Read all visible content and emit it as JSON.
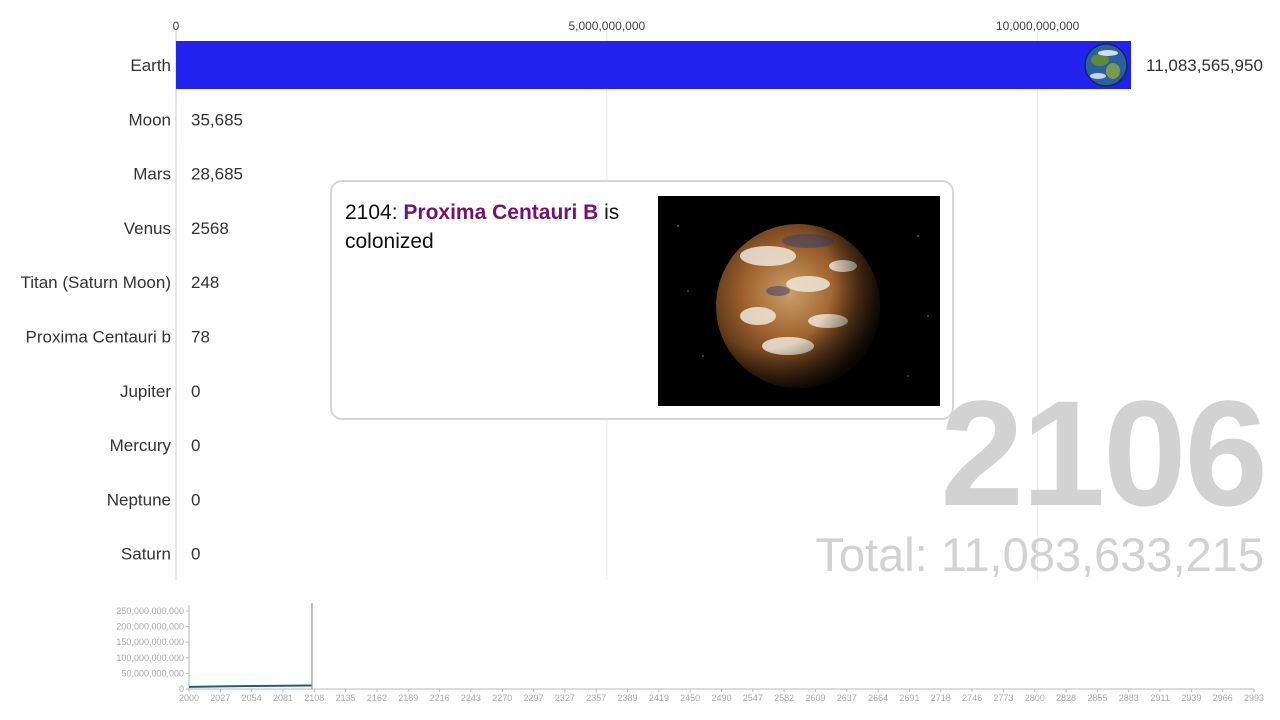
{
  "chart_data": [
    {
      "type": "bar",
      "orientation": "horizontal",
      "categories": [
        "Earth",
        "Moon",
        "Mars",
        "Venus",
        "Titan (Saturn Moon)",
        "Proxima Centauri b",
        "Jupiter",
        "Mercury",
        "Neptune",
        "Saturn"
      ],
      "values": [
        11083565950,
        35685,
        28685,
        2568,
        248,
        78,
        0,
        0,
        0,
        0
      ],
      "value_labels": [
        "11,083,565,950",
        "35,685",
        "28,685",
        "2568",
        "248",
        "78",
        "0",
        "0",
        "0",
        "0"
      ],
      "xlim": [
        0,
        11083565950
      ],
      "xticks": [
        0,
        5000000000,
        10000000000
      ],
      "xtick_labels": [
        "0",
        "5,000,000,000",
        "10,000,000,000"
      ],
      "bar_color": "#2222ee",
      "grid": true,
      "top_bar_icon": "earth-globe-icon"
    },
    {
      "type": "line",
      "x_ticks": [
        "2000",
        "2027",
        "2054",
        "2081",
        "2108",
        "2135",
        "2162",
        "2189",
        "2216",
        "2243",
        "2270",
        "2297",
        "2327",
        "2357",
        "2389",
        "2419",
        "2450",
        "2490",
        "2547",
        "2582",
        "2609",
        "2637",
        "2664",
        "2691",
        "2718",
        "2746",
        "2773",
        "2800",
        "2828",
        "2855",
        "2883",
        "2911",
        "2939",
        "2966",
        "2993"
      ],
      "y_ticks": [
        "0",
        "50,000,000,000",
        "100,000,000,000",
        "150,000,000,000",
        "200,000,000,000",
        "250,000,000,000"
      ],
      "ylim": [
        0,
        250000000000
      ],
      "x": [
        2000,
        2027,
        2054,
        2081,
        2106
      ],
      "values": [
        7000000000,
        8500000000,
        9700000000,
        10500000000,
        11083633215
      ],
      "line_color": "#1f5f7a",
      "current_year": 2106
    }
  ],
  "event": {
    "year_prefix": "2104: ",
    "highlight": "Proxima Centauri B",
    "suffix": " is colonized",
    "image": "proxima-centauri-b-planet-image"
  },
  "year": "2106",
  "total": "Total: 11,083,633,215"
}
